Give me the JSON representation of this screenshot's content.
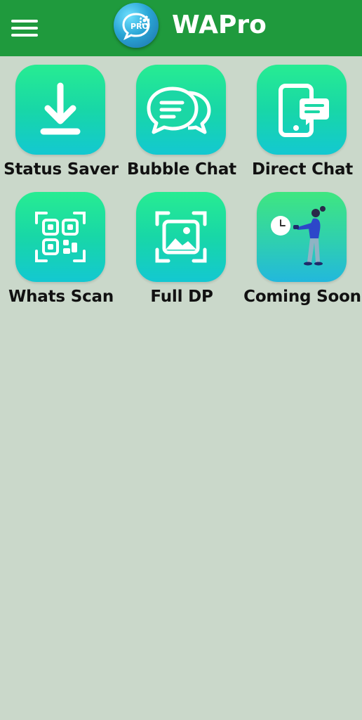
{
  "appbar": {
    "title": "WAPro",
    "menu_icon": "hamburger-menu-icon",
    "logo_icon": "wapro-logo-icon",
    "logo_text": "PRO",
    "background": "#1f9a3d"
  },
  "tiles": [
    {
      "label": "Status Saver",
      "icon": "download-icon"
    },
    {
      "label": "Bubble Chat",
      "icon": "chat-bubbles-icon"
    },
    {
      "label": "Direct Chat",
      "icon": "phone-message-icon"
    },
    {
      "label": "Whats Scan",
      "icon": "qr-scan-icon"
    },
    {
      "label": "Full DP",
      "icon": "image-frame-icon"
    },
    {
      "label": "Coming Soon",
      "icon": "person-clock-illustration"
    }
  ],
  "colors": {
    "page_background": "#cad8ca",
    "tile_gradient_top": "#27ec92",
    "tile_gradient_bottom": "#13c8d1",
    "label_text": "#111111"
  }
}
